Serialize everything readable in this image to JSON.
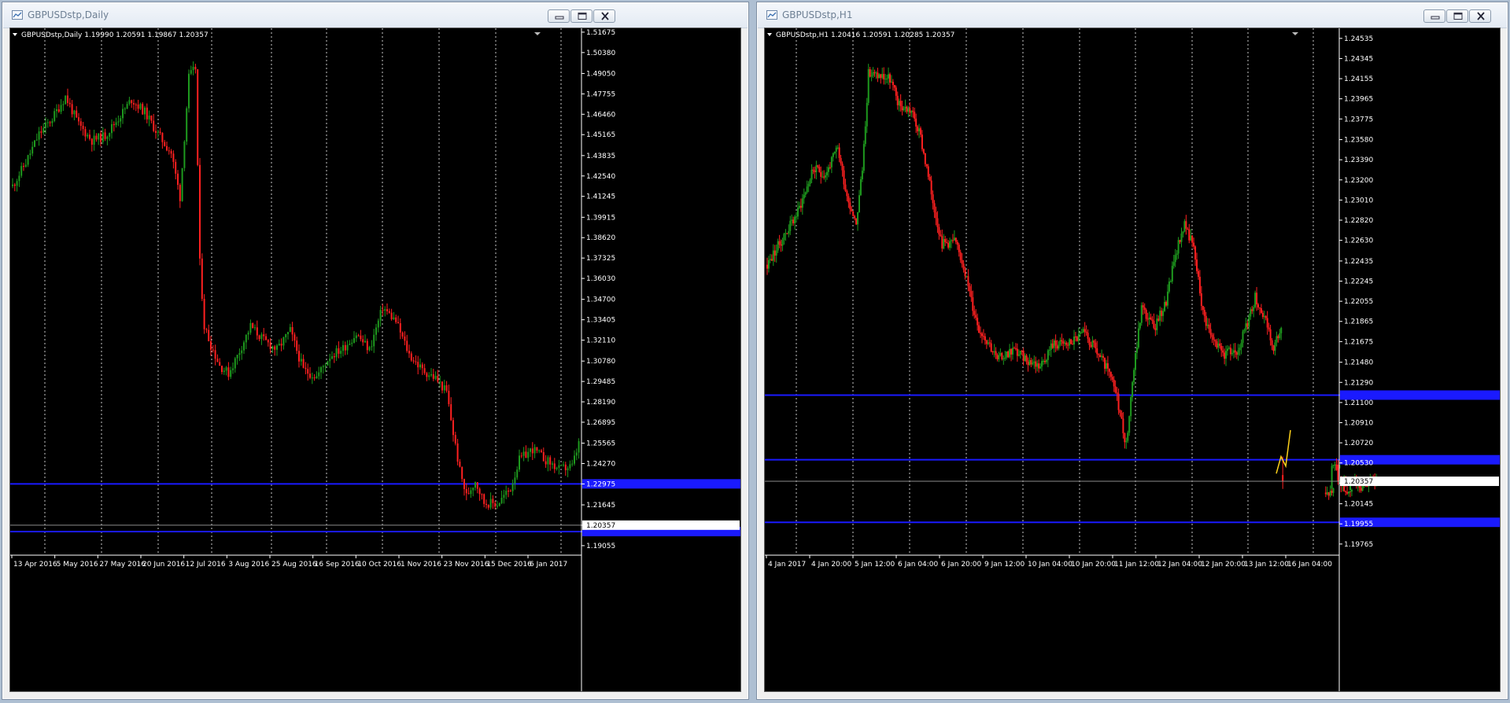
{
  "colors": {
    "background": "#000000",
    "bull": "#1e9a1e",
    "bear": "#ff2020",
    "grid": "#c8c8c8",
    "level": "#1a1aff",
    "bid": "#8c8c8c",
    "scale": "#ffffff"
  },
  "windows": [
    {
      "title": "GBPUSDstp,Daily",
      "window_icon": "chart-window-icon",
      "buttons": [
        "minimize-icon",
        "restore-icon",
        "close-icon"
      ],
      "ohlc_header": "GBPUSDstp,Daily  1.19990 1.20591 1.19867 1.20357",
      "current_price_label": "1.20357",
      "price_ticks": [
        "1.51675",
        "1.50380",
        "1.49050",
        "1.47755",
        "1.46460",
        "1.45165",
        "1.43835",
        "1.42540",
        "1.41245",
        "1.39915",
        "1.38620",
        "1.37325",
        "1.36030",
        "1.34700",
        "1.33405",
        "1.32110",
        "1.30780",
        "1.29485",
        "1.28190",
        "1.26895",
        "1.25565",
        "1.24270",
        "1.22975",
        "1.21645",
        "1.20350",
        "1.19055"
      ],
      "time_ticks": [
        "13 Apr 2016",
        "5 May 2016",
        "27 May 2016",
        "20 Jun 2016",
        "12 Jul 2016",
        "3 Aug 2016",
        "25 Aug 2016",
        "16 Sep 2016",
        "10 Oct 2016",
        "1 Nov 2016",
        "23 Nov 2016",
        "15 Dec 2016",
        "6 Jan 2017"
      ],
      "chart_data": {
        "type": "candlestick",
        "symbol": "GBPUSDstp",
        "timeframe": "Daily",
        "last": {
          "open": 1.1999,
          "high": 1.20591,
          "low": 1.19867,
          "close": 1.20357
        },
        "ylim": [
          1.1845,
          1.5192
        ],
        "x_range": [
          "13 Apr 2016",
          "10 Jan 2017"
        ],
        "horizontal_levels": [
          1.2298,
          1.1995
        ],
        "price_path": [
          [
            0,
            1.419
          ],
          [
            6,
            1.434
          ],
          [
            12,
            1.452
          ],
          [
            18,
            1.462
          ],
          [
            24,
            1.476
          ],
          [
            30,
            1.458
          ],
          [
            36,
            1.448
          ],
          [
            42,
            1.451
          ],
          [
            48,
            1.462
          ],
          [
            54,
            1.474
          ],
          [
            60,
            1.466
          ],
          [
            66,
            1.452
          ],
          [
            72,
            1.44
          ],
          [
            76,
            1.412
          ],
          [
            80,
            1.488
          ],
          [
            83,
            1.494
          ],
          [
            85,
            1.37
          ],
          [
            87,
            1.33
          ],
          [
            90,
            1.318
          ],
          [
            94,
            1.305
          ],
          [
            98,
            1.3
          ],
          [
            102,
            1.311
          ],
          [
            108,
            1.33
          ],
          [
            114,
            1.321
          ],
          [
            120,
            1.315
          ],
          [
            126,
            1.327
          ],
          [
            132,
            1.302
          ],
          [
            138,
            1.298
          ],
          [
            144,
            1.311
          ],
          [
            150,
            1.316
          ],
          [
            156,
            1.325
          ],
          [
            162,
            1.315
          ],
          [
            168,
            1.342
          ],
          [
            174,
            1.333
          ],
          [
            180,
            1.312
          ],
          [
            186,
            1.302
          ],
          [
            192,
            1.297
          ],
          [
            197,
            1.288
          ],
          [
            200,
            1.262
          ],
          [
            203,
            1.238
          ],
          [
            206,
            1.222
          ],
          [
            210,
            1.232
          ],
          [
            214,
            1.218
          ],
          [
            220,
            1.217
          ],
          [
            226,
            1.227
          ],
          [
            230,
            1.245
          ],
          [
            236,
            1.252
          ],
          [
            242,
            1.245
          ],
          [
            248,
            1.239
          ],
          [
            254,
            1.241
          ],
          [
            258,
            1.26
          ],
          [
            262,
            1.267
          ],
          [
            266,
            1.252
          ],
          [
            270,
            1.245
          ],
          [
            276,
            1.236
          ],
          [
            282,
            1.226
          ],
          [
            288,
            1.232
          ],
          [
            292,
            1.239
          ],
          [
            296,
            1.222
          ],
          [
            300,
            1.214
          ],
          [
            304,
            1.2036
          ]
        ]
      }
    },
    {
      "title": "GBPUSDstp,H1",
      "window_icon": "chart-window-icon",
      "buttons": [
        "minimize-icon",
        "restore-icon",
        "close-icon"
      ],
      "ohlc_header": "GBPUSDstp,H1  1.20416 1.20591 1.20285 1.20357",
      "current_price_label": "1.20357",
      "price_ticks": [
        "1.24535",
        "1.24345",
        "1.24155",
        "1.23965",
        "1.23775",
        "1.23580",
        "1.23390",
        "1.23200",
        "1.23010",
        "1.22820",
        "1.22630",
        "1.22435",
        "1.22245",
        "1.22055",
        "1.21865",
        "1.21675",
        "1.21480",
        "1.21290",
        "1.21100",
        "1.20910",
        "1.20720",
        "1.20530",
        "1.20340",
        "1.20145",
        "1.19955",
        "1.19765"
      ],
      "time_ticks": [
        "4 Jan 2017",
        "4 Jan 20:00",
        "5 Jan 12:00",
        "6 Jan 04:00",
        "6 Jan 20:00",
        "9 Jan 12:00",
        "10 Jan 04:00",
        "10 Jan 20:00",
        "11 Jan 12:00",
        "12 Jan 04:00",
        "12 Jan 20:00",
        "13 Jan 12:00",
        "16 Jan 04:00"
      ],
      "chart_data": {
        "type": "candlestick",
        "symbol": "GBPUSDstp",
        "timeframe": "H1",
        "last": {
          "open": 1.20416,
          "high": 1.20591,
          "low": 1.20285,
          "close": 1.20357
        },
        "ylim": [
          1.1966,
          1.2463
        ],
        "x_range": [
          "4 Jan 2017",
          "16 Jan 2017"
        ],
        "horizontal_levels": [
          1.2117,
          1.2056,
          1.1997
        ],
        "price_path": [
          [
            0,
            1.224
          ],
          [
            10,
            1.2265
          ],
          [
            20,
            1.229
          ],
          [
            30,
            1.233
          ],
          [
            38,
            1.2325
          ],
          [
            46,
            1.235
          ],
          [
            52,
            1.2305
          ],
          [
            58,
            1.228
          ],
          [
            62,
            1.233
          ],
          [
            66,
            1.242
          ],
          [
            74,
            1.2418
          ],
          [
            80,
            1.2415
          ],
          [
            86,
            1.239
          ],
          [
            94,
            1.2385
          ],
          [
            100,
            1.236
          ],
          [
            108,
            1.23
          ],
          [
            114,
            1.226
          ],
          [
            122,
            1.2262
          ],
          [
            128,
            1.224
          ],
          [
            134,
            1.22
          ],
          [
            138,
            1.218
          ],
          [
            144,
            1.2168
          ],
          [
            150,
            1.215
          ],
          [
            160,
            1.216
          ],
          [
            170,
            1.215
          ],
          [
            178,
            1.2145
          ],
          [
            186,
            1.2165
          ],
          [
            196,
            1.2165
          ],
          [
            206,
            1.2175
          ],
          [
            214,
            1.216
          ],
          [
            222,
            1.214
          ],
          [
            228,
            1.2115
          ],
          [
            234,
            1.207
          ],
          [
            238,
            1.213
          ],
          [
            244,
            1.22
          ],
          [
            252,
            1.218
          ],
          [
            260,
            1.2205
          ],
          [
            266,
            1.225
          ],
          [
            272,
            1.228
          ],
          [
            278,
            1.2255
          ],
          [
            284,
            1.2195
          ],
          [
            290,
            1.217
          ],
          [
            298,
            1.2155
          ],
          [
            306,
            1.216
          ],
          [
            312,
            1.218
          ],
          [
            318,
            1.221
          ],
          [
            324,
            1.219
          ],
          [
            330,
            1.216
          ],
          [
            336,
            1.2185
          ]
        ],
        "gap_segment": [
          [
            364,
            1.2025
          ],
          [
            368,
            1.205
          ],
          [
            372,
            1.2035
          ],
          [
            376,
            1.2025
          ],
          [
            380,
            1.2035
          ],
          [
            386,
            1.203
          ],
          [
            392,
            1.2036
          ]
        ],
        "projection_line": [
          [
            0,
            1.2043
          ],
          [
            1,
            1.2059
          ],
          [
            2,
            1.205
          ],
          [
            3,
            1.2084
          ]
        ]
      }
    }
  ]
}
